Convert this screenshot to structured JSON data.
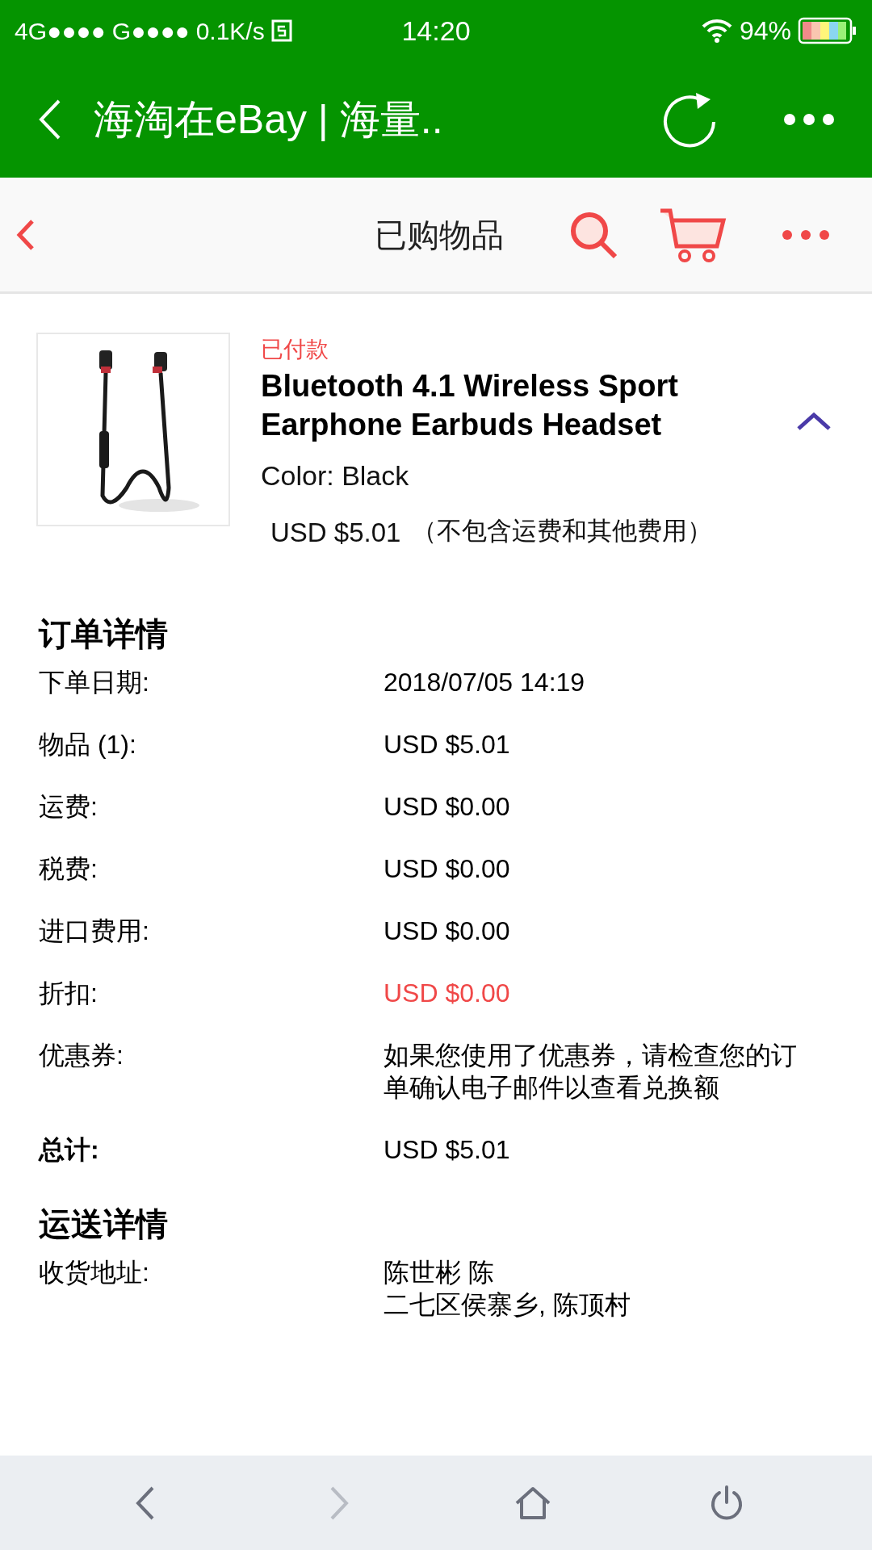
{
  "status_bar": {
    "signal": "4G●●●● G●●●●",
    "speed": "0.1K/s",
    "time": "14:20",
    "battery": "94%"
  },
  "browser_bar": {
    "title": "海淘在eBay | 海量.."
  },
  "page_header": {
    "title": "已购物品"
  },
  "product": {
    "status": "已付款",
    "title": "Bluetooth 4.1 Wireless Sport Earphone Earbuds Headset",
    "variation": "Color: Black",
    "price": "USD $5.01",
    "price_note": "（不包含运费和其他费用）",
    "expanded": true
  },
  "order_details": {
    "title": "订单详情",
    "rows": [
      {
        "label": "下单日期:",
        "value": "2018/07/05 14:19",
        "kind": "normal"
      },
      {
        "label": "物品 (1):",
        "value": "USD $5.01",
        "kind": "normal"
      },
      {
        "label": "运费:",
        "value": "USD $0.00",
        "kind": "normal"
      },
      {
        "label": "税费:",
        "value": "USD $0.00",
        "kind": "normal"
      },
      {
        "label": "进口费用:",
        "value": "USD $0.00",
        "kind": "normal"
      },
      {
        "label": "折扣:",
        "value": "USD $0.00",
        "kind": "discount"
      },
      {
        "label": "优惠券:",
        "value": "如果您使用了优惠券，请检查您的订单确认电子邮件以查看兑换额",
        "kind": "normal"
      },
      {
        "label": "总计:",
        "value": "USD $5.01",
        "kind": "total"
      }
    ]
  },
  "shipping_details": {
    "title": "运送详情",
    "rows": [
      {
        "label": "收货地址:",
        "lines": [
          "陈世彬 陈",
          "二七区侯寨乡, 陈顶村"
        ]
      }
    ]
  },
  "bottom_nav": [
    {
      "kind": "back",
      "disabled": false
    },
    {
      "kind": "forward",
      "disabled": true
    },
    {
      "kind": "home",
      "disabled": false
    },
    {
      "kind": "power",
      "disabled": false
    }
  ]
}
